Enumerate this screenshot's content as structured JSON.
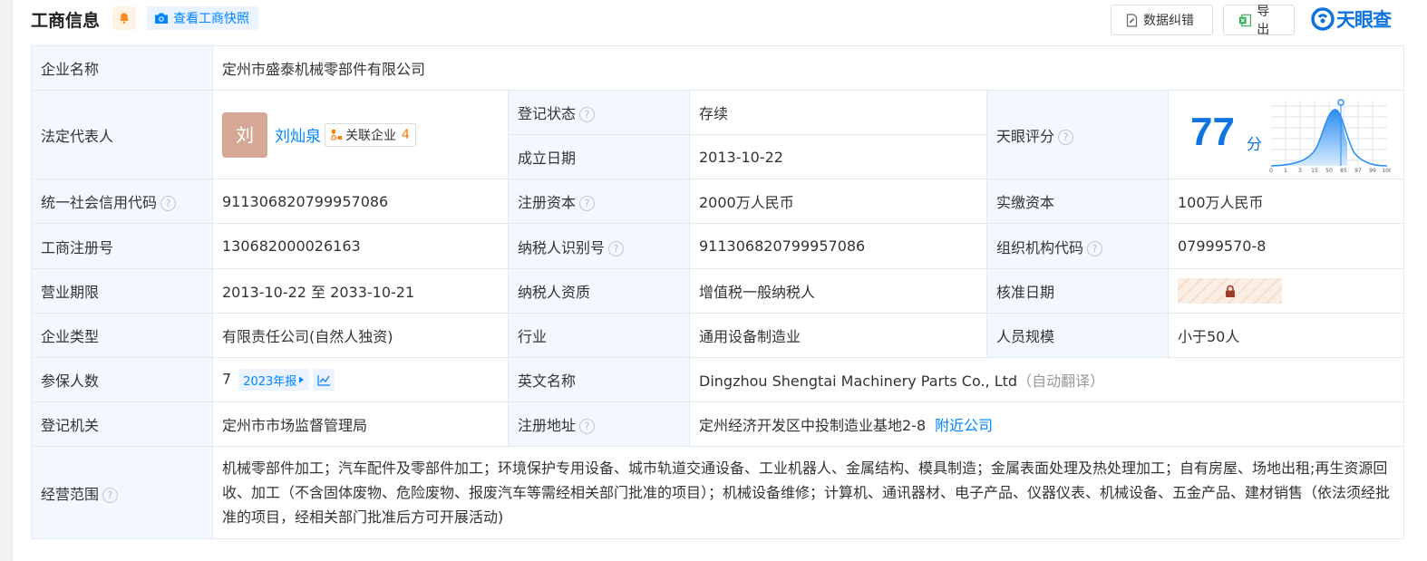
{
  "header": {
    "title": "工商信息",
    "snapshot_label": "查看工商快照",
    "correct_label": "数据纠错",
    "export_label": "导出",
    "logo_text": "天眼查"
  },
  "company": {
    "name_label": "企业名称",
    "name": "定州市盛泰机械零部件有限公司",
    "legal_rep_label": "法定代表人",
    "legal_rep_avatar": "刘",
    "legal_rep_name": "刘灿泉",
    "related_label": "关联企业",
    "related_count": "4",
    "status_label": "登记状态",
    "status": "存续",
    "founded_label": "成立日期",
    "founded": "2013-10-22",
    "score_label": "天眼评分",
    "score": "77",
    "score_unit": "分",
    "score_axis": [
      "0",
      "1",
      "3",
      "15",
      "50",
      "85",
      "97",
      "99",
      "100"
    ],
    "credit_code_label": "统一社会信用代码",
    "credit_code": "911306820799957086",
    "reg_capital_label": "注册资本",
    "reg_capital": "2000万人民币",
    "paid_capital_label": "实缴资本",
    "paid_capital": "100万人民币",
    "biz_reg_no_label": "工商注册号",
    "biz_reg_no": "130682000026163",
    "taxpayer_id_label": "纳税人识别号",
    "taxpayer_id": "911306820799957086",
    "org_code_label": "组织机构代码",
    "org_code": "07999570-8",
    "term_label": "营业期限",
    "term": "2013-10-22 至 2033-10-21",
    "tax_qual_label": "纳税人资质",
    "tax_qual": "增值税一般纳税人",
    "approved_label": "核准日期",
    "type_label": "企业类型",
    "type": "有限责任公司(自然人独资)",
    "industry_label": "行业",
    "industry": "通用设备制造业",
    "staff_label": "人员规模",
    "staff": "小于50人",
    "insured_label": "参保人数",
    "insured": "7",
    "insured_year_tag": "2023年报",
    "english_label": "英文名称",
    "english": "Dingzhou Shengtai Machinery Parts Co., Ltd",
    "auto_translate": "（自动翻译）",
    "authority_label": "登记机关",
    "authority": "定州市市场监督管理局",
    "address_label": "注册地址",
    "address": "定州经济开发区中投制造业基地2-8",
    "nearby_label": "附近公司",
    "scope_label": "经营范围",
    "scope": "机械零部件加工；汽车配件及零部件加工；环境保护专用设备、城市轨道交通设备、工业机器人、金属结构、模具制造；金属表面处理及热处理加工；自有房屋、场地出租;再生资源回收、加工（不含固体废物、危险废物、报废汽车等需经相关部门批准的项目）；机械设备维修；计算机、通讯器材、电子产品、仪器仪表、机械设备、五金产品、建材销售（依法须经批准的项目，经相关部门批准后方可开展活动)"
  },
  "colors": {
    "accent": "#0084ff",
    "brand": "#0d74e0",
    "status_green": "#2eab54",
    "label_bg": "#f3f8fe",
    "related_count": "#ff7a00"
  }
}
